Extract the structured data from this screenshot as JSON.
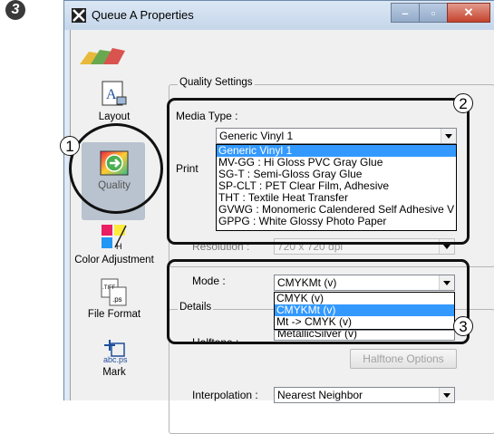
{
  "step": {
    "number": "3"
  },
  "window": {
    "title": "Queue A Properties"
  },
  "sidebar": {
    "items": [
      {
        "label": "Layout"
      },
      {
        "label": "Quality"
      },
      {
        "label": "Color Adjustment"
      },
      {
        "label": "File Format"
      },
      {
        "label": "Mark"
      }
    ]
  },
  "quality_settings": {
    "group_label": "Quality Settings",
    "media_type_label": "Media Type :",
    "media_type_value": "Generic Vinyl 1",
    "media_options": [
      "Generic Vinyl 1",
      "MV-GG : Hi Gloss PVC Gray Glue",
      "SG-T : Semi-Gloss Gray Glue",
      "SP-CLT : PET Clear Film, Adhesive",
      "THT : Textile Heat Transfer",
      "GVWG : Monomeric Calendered Self Adhesive V",
      "GPPG : White Glossy Photo Paper"
    ],
    "print_label": "Print",
    "resolution_label": "Resolution :",
    "resolution_value": "720 x 720 dpi",
    "mode_label": "Mode :",
    "mode_value": "CMYKMt (v)",
    "mode_options": [
      "CMYK (v)",
      "CMYKMt (v)",
      "Mt -> CMYK (v)"
    ],
    "mode_under_value": "MetallicSilver (v)"
  },
  "details": {
    "group_label": "Details",
    "halftone_label": "Halftone :",
    "halftone_options_button": "Halftone Options",
    "interpolation_label": "Interpolation :",
    "interpolation_value": "Nearest Neighbor"
  },
  "callouts": [
    "1",
    "2",
    "3"
  ],
  "colors": {
    "highlight": "#3399ff",
    "outline": "#111111"
  }
}
